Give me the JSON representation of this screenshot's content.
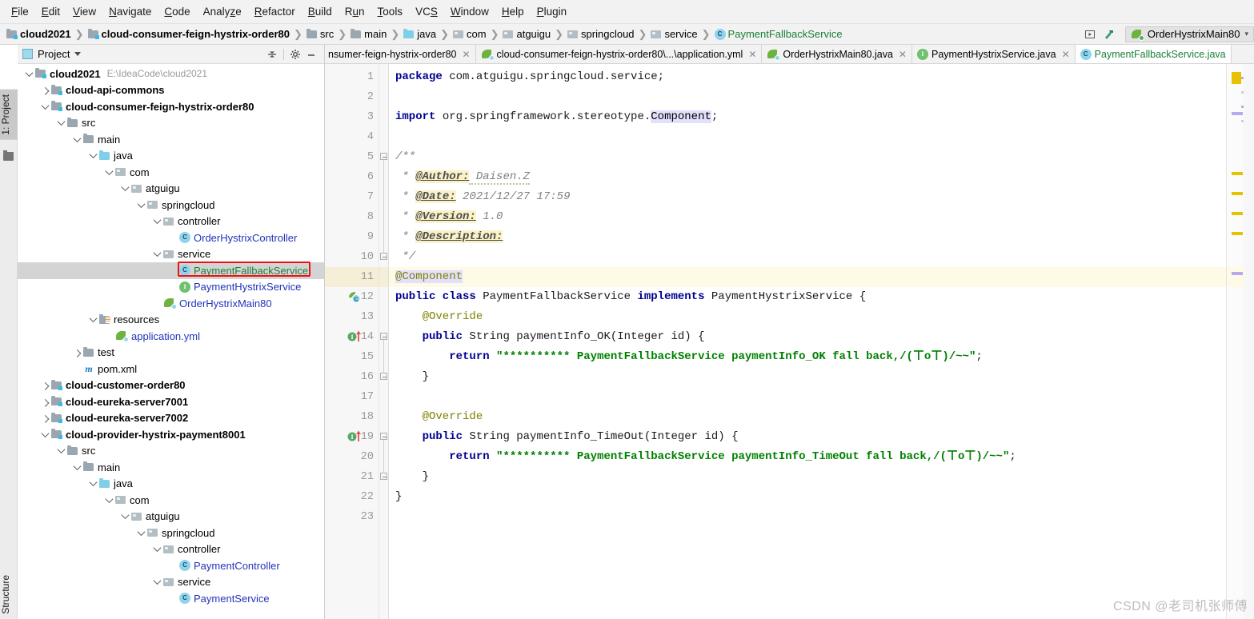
{
  "menubar": {
    "items": [
      {
        "label": "File",
        "mnemonic": "F"
      },
      {
        "label": "Edit",
        "mnemonic": "E"
      },
      {
        "label": "View",
        "mnemonic": "V"
      },
      {
        "label": "Navigate",
        "mnemonic": "N"
      },
      {
        "label": "Code",
        "mnemonic": "C"
      },
      {
        "label": "Analyze",
        "mnemonic": "z"
      },
      {
        "label": "Refactor",
        "mnemonic": "R"
      },
      {
        "label": "Build",
        "mnemonic": "B"
      },
      {
        "label": "Run",
        "mnemonic": "u"
      },
      {
        "label": "Tools",
        "mnemonic": "T"
      },
      {
        "label": "VCS",
        "mnemonic": "S"
      },
      {
        "label": "Window",
        "mnemonic": "W"
      },
      {
        "label": "Help",
        "mnemonic": "H"
      },
      {
        "label": "Plugin",
        "mnemonic": "P"
      }
    ]
  },
  "breadcrumb": {
    "items": [
      {
        "label": "cloud2021",
        "icon": "module-icon",
        "bold": true
      },
      {
        "label": "cloud-consumer-feign-hystrix-order80",
        "icon": "module-icon",
        "bold": true
      },
      {
        "label": "src",
        "icon": "folder-icon",
        "bold": false
      },
      {
        "label": "main",
        "icon": "folder-icon",
        "bold": false
      },
      {
        "label": "java",
        "icon": "folder-blue-icon",
        "bold": false
      },
      {
        "label": "com",
        "icon": "package-icon",
        "bold": false
      },
      {
        "label": "atguigu",
        "icon": "package-icon",
        "bold": false
      },
      {
        "label": "springcloud",
        "icon": "package-icon",
        "bold": false
      },
      {
        "label": "service",
        "icon": "package-icon",
        "bold": false
      },
      {
        "label": "PaymentFallbackService",
        "icon": "class-icon",
        "bold": false,
        "green": true
      }
    ]
  },
  "toolbar_right": {
    "select_target_icon": "select-run-target-icon",
    "hammer_icon": "build-hammer-icon",
    "run_config": "OrderHystrixMain80",
    "run_config_icon": "spring-boot-icon"
  },
  "tool_window_left": {
    "project_tab": "1: Project",
    "project_tab_mnemonic": "1",
    "structure_tab": "Structure",
    "favorites_icon": "favorites-folder-icon"
  },
  "project_panel": {
    "title": "Project",
    "collapse_all_icon": "collapse-all-icon",
    "settings_icon": "gear-icon",
    "hide_icon": "minimize-icon",
    "tree": [
      {
        "label": "cloud2021",
        "path": "E:\\IdeaCode\\cloud2021",
        "indent": 0,
        "twisty": "down",
        "icon": "module-icon",
        "bold": true
      },
      {
        "label": "cloud-api-commons",
        "indent": 1,
        "twisty": "right",
        "icon": "module-icon",
        "bold": true
      },
      {
        "label": "cloud-consumer-feign-hystrix-order80",
        "indent": 1,
        "twisty": "down",
        "icon": "module-icon",
        "bold": true
      },
      {
        "label": "src",
        "indent": 2,
        "twisty": "down",
        "icon": "folder-icon"
      },
      {
        "label": "main",
        "indent": 3,
        "twisty": "down",
        "icon": "folder-icon"
      },
      {
        "label": "java",
        "indent": 4,
        "twisty": "down",
        "icon": "folder-blue-icon"
      },
      {
        "label": "com",
        "indent": 5,
        "twisty": "down",
        "icon": "package-icon"
      },
      {
        "label": "atguigu",
        "indent": 6,
        "twisty": "down",
        "icon": "package-icon"
      },
      {
        "label": "springcloud",
        "indent": 7,
        "twisty": "down",
        "icon": "package-icon"
      },
      {
        "label": "controller",
        "indent": 8,
        "twisty": "down",
        "icon": "package-icon"
      },
      {
        "label": "OrderHystrixController",
        "indent": 9,
        "twisty": "none",
        "icon": "class-icon",
        "color": "blue"
      },
      {
        "label": "service",
        "indent": 8,
        "twisty": "down",
        "icon": "package-icon"
      },
      {
        "label": "PaymentFallbackService",
        "indent": 9,
        "twisty": "none",
        "icon": "class-icon",
        "color": "green",
        "selected": true,
        "highlighted": true
      },
      {
        "label": "PaymentHystrixService",
        "indent": 9,
        "twisty": "none",
        "icon": "interface-icon",
        "color": "blue"
      },
      {
        "label": "OrderHystrixMain80",
        "indent": 8,
        "twisty": "none",
        "icon": "spring-boot-icon",
        "color": "blue"
      },
      {
        "label": "resources",
        "indent": 4,
        "twisty": "down",
        "icon": "resources-folder-icon"
      },
      {
        "label": "application.yml",
        "indent": 5,
        "twisty": "none",
        "icon": "spring-yaml-icon",
        "color": "blue"
      },
      {
        "label": "test",
        "indent": 3,
        "twisty": "right",
        "icon": "folder-icon"
      },
      {
        "label": "pom.xml",
        "indent": 3,
        "twisty": "none",
        "icon": "maven-icon"
      },
      {
        "label": "cloud-customer-order80",
        "indent": 1,
        "twisty": "right",
        "icon": "module-icon",
        "bold": true
      },
      {
        "label": "cloud-eureka-server7001",
        "indent": 1,
        "twisty": "right",
        "icon": "module-icon",
        "bold": true
      },
      {
        "label": "cloud-eureka-server7002",
        "indent": 1,
        "twisty": "right",
        "icon": "module-icon",
        "bold": true
      },
      {
        "label": "cloud-provider-hystrix-payment8001",
        "indent": 1,
        "twisty": "down",
        "icon": "module-icon",
        "bold": true
      },
      {
        "label": "src",
        "indent": 2,
        "twisty": "down",
        "icon": "folder-icon"
      },
      {
        "label": "main",
        "indent": 3,
        "twisty": "down",
        "icon": "folder-icon"
      },
      {
        "label": "java",
        "indent": 4,
        "twisty": "down",
        "icon": "folder-blue-icon"
      },
      {
        "label": "com",
        "indent": 5,
        "twisty": "down",
        "icon": "package-icon"
      },
      {
        "label": "atguigu",
        "indent": 6,
        "twisty": "down",
        "icon": "package-icon"
      },
      {
        "label": "springcloud",
        "indent": 7,
        "twisty": "down",
        "icon": "package-icon"
      },
      {
        "label": "controller",
        "indent": 8,
        "twisty": "down",
        "icon": "package-icon"
      },
      {
        "label": "PaymentController",
        "indent": 9,
        "twisty": "none",
        "icon": "class-icon",
        "color": "blue"
      },
      {
        "label": "service",
        "indent": 8,
        "twisty": "down",
        "icon": "package-icon"
      },
      {
        "label": "PaymentService",
        "indent": 9,
        "twisty": "none",
        "icon": "class-icon",
        "color": "blue"
      }
    ]
  },
  "editor_tabs": [
    {
      "label": "nsumer-feign-hystrix-order80",
      "icon": "none",
      "active": false,
      "closable": true,
      "clipped": true
    },
    {
      "label": "cloud-consumer-feign-hystrix-order80\\...\\application.yml",
      "icon": "spring-yaml-icon",
      "active": false,
      "closable": true
    },
    {
      "label": "OrderHystrixMain80.java",
      "icon": "spring-boot-icon",
      "active": false,
      "closable": true
    },
    {
      "label": "PaymentHystrixService.java",
      "icon": "interface-icon",
      "active": false,
      "closable": true
    },
    {
      "label": "PaymentFallbackService.java",
      "icon": "class-icon",
      "active": true,
      "closable": false
    }
  ],
  "editor": {
    "file_name": "PaymentFallbackService.java",
    "current_line": 11,
    "lines": [
      {
        "n": 1,
        "segments": [
          {
            "t": "package",
            "c": "kw"
          },
          {
            "t": " com.atguigu.springcloud.service;",
            "c": "plain"
          }
        ]
      },
      {
        "n": 2,
        "segments": []
      },
      {
        "n": 3,
        "segments": [
          {
            "t": "import",
            "c": "kw"
          },
          {
            "t": " org.springframework.stereotype.",
            "c": "plain"
          },
          {
            "t": "Component",
            "c": "ident-hl"
          },
          {
            "t": ";",
            "c": "plain"
          }
        ]
      },
      {
        "n": 4,
        "segments": []
      },
      {
        "n": 5,
        "segments": [
          {
            "t": "/**",
            "c": "cmt"
          }
        ],
        "fold": "start"
      },
      {
        "n": 6,
        "segments": [
          {
            "t": " * ",
            "c": "cmt"
          },
          {
            "t": "@Author:",
            "c": "doctag"
          },
          {
            "t": " Daisen.Z",
            "c": "docval squig"
          }
        ]
      },
      {
        "n": 7,
        "segments": [
          {
            "t": " * ",
            "c": "cmt"
          },
          {
            "t": "@Date:",
            "c": "doctag"
          },
          {
            "t": " 2021/12/27 17:59",
            "c": "docval"
          }
        ]
      },
      {
        "n": 8,
        "segments": [
          {
            "t": " * ",
            "c": "cmt"
          },
          {
            "t": "@Version:",
            "c": "doctag"
          },
          {
            "t": " 1.0",
            "c": "docval"
          }
        ]
      },
      {
        "n": 9,
        "segments": [
          {
            "t": " * ",
            "c": "cmt"
          },
          {
            "t": "@Description:",
            "c": "doctag"
          }
        ]
      },
      {
        "n": 10,
        "segments": [
          {
            "t": " */",
            "c": "cmt"
          }
        ],
        "fold": "end"
      },
      {
        "n": 11,
        "segments": [
          {
            "t": "@Component",
            "c": "anno annobg"
          }
        ],
        "highlight": true
      },
      {
        "n": 12,
        "segments": [
          {
            "t": "public class",
            "c": "kw"
          },
          {
            "t": " PaymentFallbackService ",
            "c": "plain"
          },
          {
            "t": "implements",
            "c": "kw"
          },
          {
            "t": " PaymentHystrixService {",
            "c": "plain"
          }
        ],
        "gutter_icon": "spring-bean-icon"
      },
      {
        "n": 13,
        "segments": [
          {
            "t": "    @Override",
            "c": "anno"
          }
        ]
      },
      {
        "n": 14,
        "segments": [
          {
            "t": "    ",
            "c": "plain"
          },
          {
            "t": "public",
            "c": "kw"
          },
          {
            "t": " String paymentInfo_OK(Integer id) {",
            "c": "plain"
          }
        ],
        "gutter_icon": "implementing-method-icon",
        "fold": "start"
      },
      {
        "n": 15,
        "segments": [
          {
            "t": "        ",
            "c": "plain"
          },
          {
            "t": "return",
            "c": "kw"
          },
          {
            "t": " ",
            "c": "plain"
          },
          {
            "t": "\"********** PaymentFallbackService paymentInfo_OK fall back,/(ㄒoㄒ)/~~\"",
            "c": "str"
          },
          {
            "t": ";",
            "c": "plain"
          }
        ]
      },
      {
        "n": 16,
        "segments": [
          {
            "t": "    }",
            "c": "plain"
          }
        ],
        "fold": "end"
      },
      {
        "n": 17,
        "segments": []
      },
      {
        "n": 18,
        "segments": [
          {
            "t": "    @Override",
            "c": "anno"
          }
        ]
      },
      {
        "n": 19,
        "segments": [
          {
            "t": "    ",
            "c": "plain"
          },
          {
            "t": "public",
            "c": "kw"
          },
          {
            "t": " String paymentInfo_TimeOut(Integer id) {",
            "c": "plain"
          }
        ],
        "gutter_icon": "implementing-method-icon",
        "fold": "start"
      },
      {
        "n": 20,
        "segments": [
          {
            "t": "        ",
            "c": "plain"
          },
          {
            "t": "return",
            "c": "kw"
          },
          {
            "t": " ",
            "c": "plain"
          },
          {
            "t": "\"********** PaymentFallbackService paymentInfo_TimeOut fall back,/(ㄒoㄒ)/~~\"",
            "c": "str"
          },
          {
            "t": ";",
            "c": "plain"
          }
        ]
      },
      {
        "n": 21,
        "segments": [
          {
            "t": "    }",
            "c": "plain"
          }
        ],
        "fold": "end"
      },
      {
        "n": 22,
        "segments": [
          {
            "t": "}",
            "c": "plain"
          }
        ]
      },
      {
        "n": 23,
        "segments": []
      }
    ]
  },
  "markers": [
    {
      "line": 1,
      "kind": "big",
      "color": "#e8c200"
    },
    {
      "line": 3,
      "kind": "bar",
      "color": "#b8a8f0"
    },
    {
      "line": 6,
      "kind": "bar",
      "color": "#e8c200"
    },
    {
      "line": 7,
      "kind": "bar",
      "color": "#e8c200"
    },
    {
      "line": 8,
      "kind": "bar",
      "color": "#e8c200"
    },
    {
      "line": 9,
      "kind": "bar",
      "color": "#e8c200"
    },
    {
      "line": 11,
      "kind": "bar",
      "color": "#b8a8f0"
    }
  ],
  "watermark": "CSDN @老司机张师傅",
  "colors": {
    "accent_green": "#1a7f37",
    "keyword_blue": "#00008f",
    "string_green": "#008000",
    "selection_red": "#ef1111",
    "caret_row": "#fffae6"
  }
}
